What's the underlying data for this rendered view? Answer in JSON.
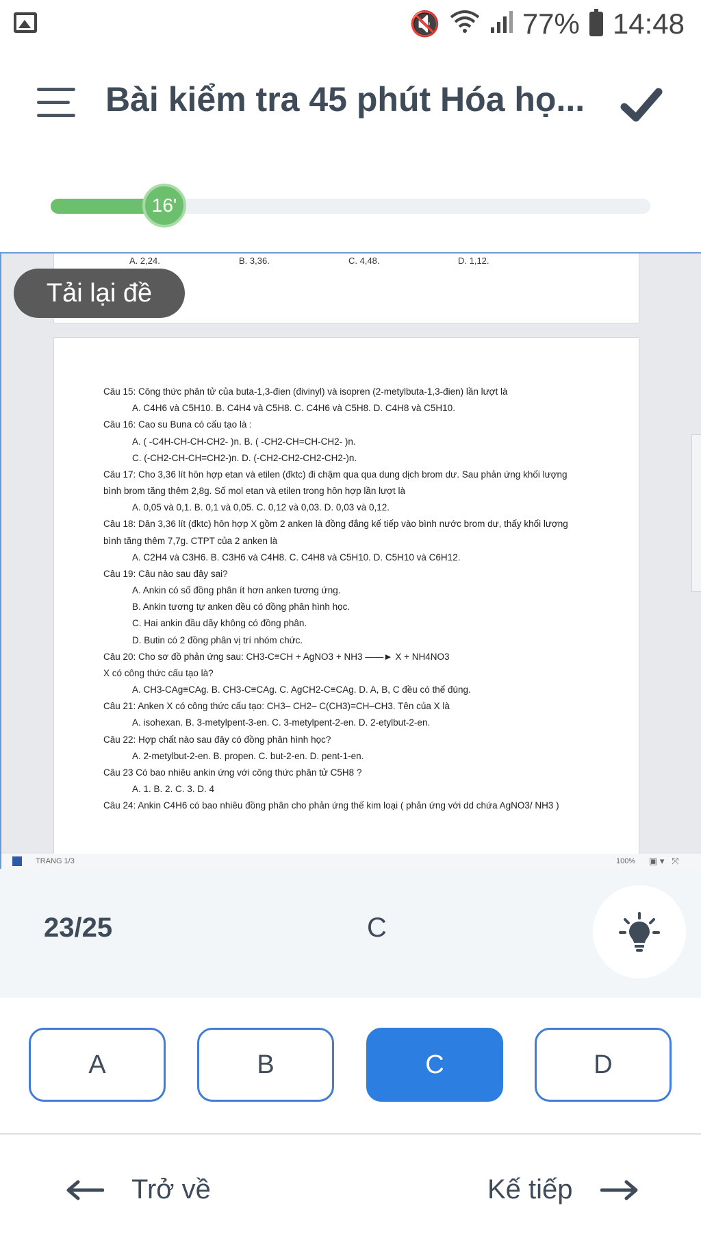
{
  "status_bar": {
    "battery": "77%",
    "time": "14:48"
  },
  "header": {
    "title": "Bài kiểm tra 45 phút Hóa họ..."
  },
  "progress": {
    "timer_label": "16'",
    "fraction": 0.19
  },
  "document": {
    "page1_options": [
      "A. 2,24.",
      "B. 3,36.",
      "C. 4,48.",
      "D. 1,12."
    ],
    "lines": [
      {
        "text": "Câu 15: Công thức phân tử của buta-1,3-đien (đivinyl) và isopren (2-metylbuta-1,3-đien) lần lượt là",
        "indent": false
      },
      {
        "text": "A. C4H6 và C5H10.   B. C4H4 và C5H8.          C. C4H6 và C5H8.          D. C4H8 và C5H10.",
        "indent": true
      },
      {
        "text": "Câu 16: Cao su Buna có cấu tạo là :",
        "indent": false
      },
      {
        "text": "A. ( -C4H-CH-CH-CH2- )n.                                              B. ( -CH2-CH=CH-CH2- )n.",
        "indent": true
      },
      {
        "text": "  C. (-CH2-CH-CH=CH2-)n.                                              D. (-CH2-CH2-CH2-CH2-)n.",
        "indent": true
      },
      {
        "text": "Câu 17: Cho 3,36 lít hỗn hợp etan và etilen (đktc) đi chậm qua qua dung dịch brom dư. Sau phản ứng khối lượng",
        "indent": false
      },
      {
        "text": "bình brom tăng thêm 2,8g. Số mol etan và etilen trong hỗn hợp lần lượt là",
        "indent": false
      },
      {
        "text": "  A. 0,05 và 0,1.               B. 0,1 và 0,05.               C. 0,12 và 0,03.  D. 0,03 và 0,12.",
        "indent": true
      },
      {
        "text": "Câu 18: Dẫn 3,36 lít (đktc) hỗn hợp X gồm 2 anken là đồng đẳng kế tiếp vào bình nước brom dư, thấy khối lượng",
        "indent": false
      },
      {
        "text": "bình tăng thêm 7,7g. CTPT của 2 anken là",
        "indent": false
      },
      {
        "text": "  A. C2H4 và C3H6. B. C3H6 và C4H8. C. C4H8 và C5H10.              D. C5H10 và C6H12.",
        "indent": true
      },
      {
        "text": "Câu 19: Câu nào sau đây sai?",
        "indent": false
      },
      {
        "text": "  A. Ankin có số đồng phân ít hơn anken tương ứng.",
        "indent": true
      },
      {
        "text": "  B. Ankin tương tự anken đều có đồng phân hình học.",
        "indent": true
      },
      {
        "text": "  C. Hai ankin đầu dãy không có đồng phân.",
        "indent": true
      },
      {
        "text": "  D. Butin có 2 đồng phân vị trí nhóm chức.",
        "indent": true
      },
      {
        "text": "Câu 20: Cho sơ đồ phản ứng sau:        CH3-C≡CH   + AgNO3 + NH3   ——►  X   +   NH4NO3",
        "indent": false
      },
      {
        "text": "X có công thức cấu tạo là?",
        "indent": false
      },
      {
        "text": "  A. CH3-CAg≡CAg.      B. CH3-C≡CAg.        C. AgCH2-C≡CAg.        D. A, B, C đều có thể đúng.",
        "indent": true
      },
      {
        "text": "Câu 21: Anken X có công thức cấu tạo: CH3– CH2– C(CH3)=CH–CH3. Tên của X là",
        "indent": false
      },
      {
        "text": "  A. isohexan.                         B. 3-metylpent-3-en.   C. 3-metylpent-2-en.       D. 2-etylbut-2-en.",
        "indent": true
      },
      {
        "text": "Câu 22: Hợp chất nào sau đây có đồng phân hình học?",
        "indent": false
      },
      {
        "text": "  A. 2-metylbut-2-en.    B. propen.          C. but-2-en.   D. pent-1-en.",
        "indent": true
      },
      {
        "text": "Câu 23 Có bao nhiêu ankin ứng với công thức phân tử C5H8 ?",
        "indent": false
      },
      {
        "text": "  A. 1.                                B. 2.                                C. 3.                              D. 4",
        "indent": true
      },
      {
        "text": "Câu 24: Ankin C4H6 có bao nhiêu đồng phân cho phản ứng thế kim loại ( phản ứng với dd chứa AgNO3/ NH3 )",
        "indent": false
      }
    ],
    "footer_page": "TRANG 1/3",
    "footer_zoom": "100%"
  },
  "reload_button": "Tải lại đề",
  "answer": {
    "counter": "23/25",
    "selected": "C"
  },
  "choices": [
    {
      "label": "A",
      "selected": false
    },
    {
      "label": "B",
      "selected": false
    },
    {
      "label": "C",
      "selected": true
    },
    {
      "label": "D",
      "selected": false
    }
  ],
  "nav": {
    "back_label": "Trở về",
    "next_label": "Kế tiếp"
  },
  "colors": {
    "accent_blue": "#2c7fe0",
    "progress_green": "#6cc06d",
    "text_dark": "#3f4b58"
  }
}
